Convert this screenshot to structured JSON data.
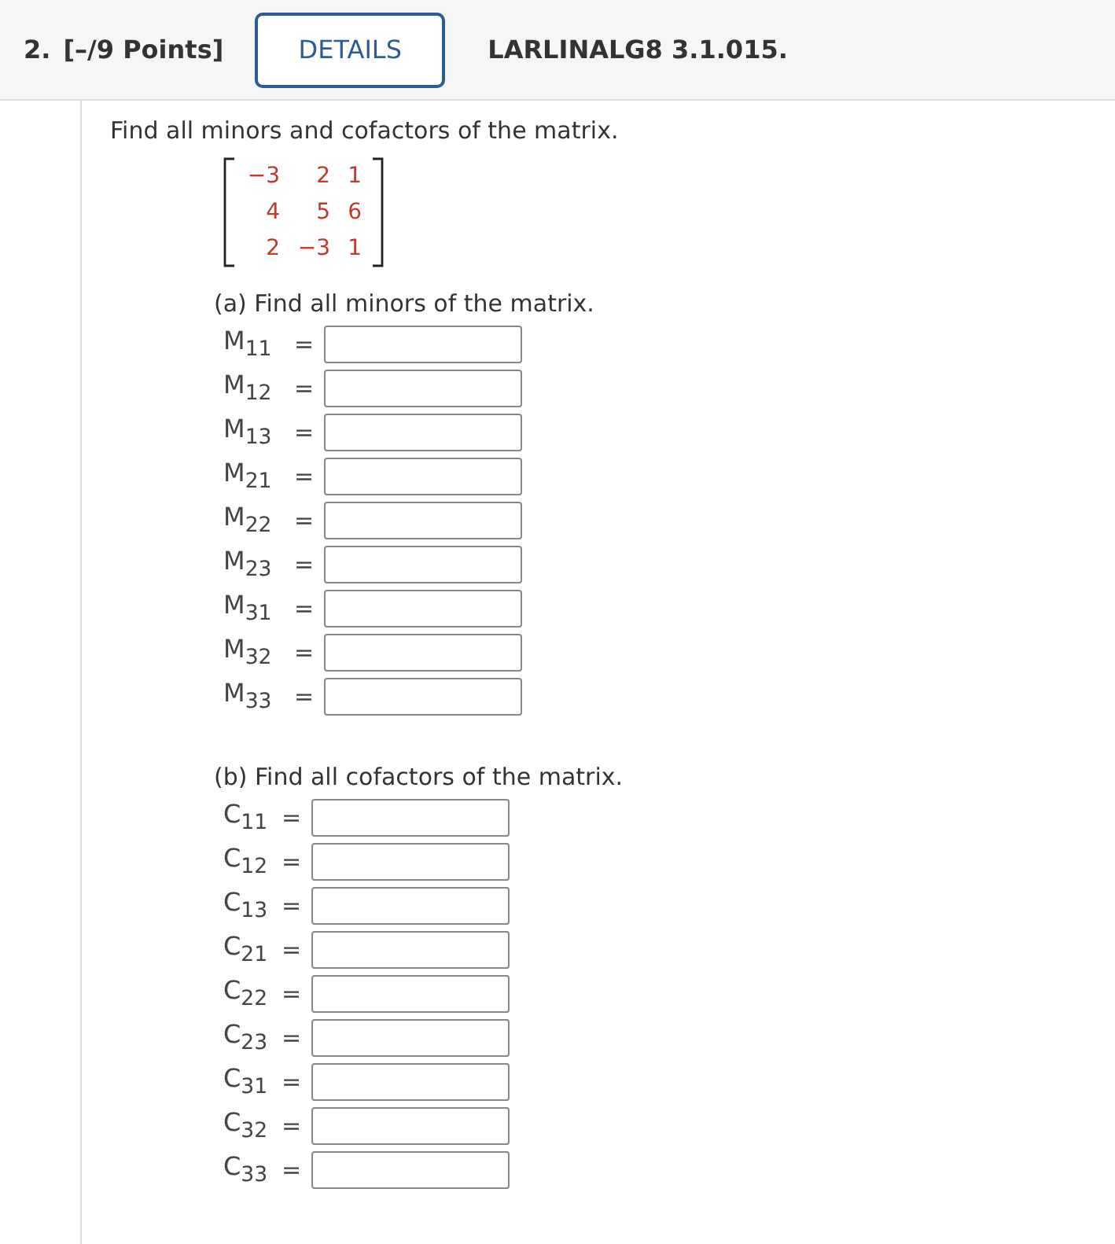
{
  "header": {
    "number": "2.",
    "points": "[–/9 Points]",
    "details_button": "DETAILS",
    "code": "LARLINALG8 3.1.015."
  },
  "prompt": "Find all minors and cofactors of the matrix.",
  "matrix": [
    [
      "−3",
      "2",
      "1"
    ],
    [
      "4",
      "5",
      "6"
    ],
    [
      "2",
      "−3",
      "1"
    ]
  ],
  "parts": [
    {
      "title": "(a) Find all minors of the matrix.",
      "answers": [
        {
          "label": "M$_{11}$",
          "sign": "="
        },
        {
          "label": "M$_{12}$",
          "sign": "="
        },
        {
          "label": "M$_{13}$",
          "sign": "="
        },
        {
          "label": "M$_{21}$",
          "sign": "="
        },
        {
          "label": "M$_{22}$",
          "sign": "="
        },
        {
          "label": "M$_{23}$",
          "sign": "="
        },
        {
          "label": "M$_{31}$",
          "sign": "="
        },
        {
          "label": "M$_{32}$",
          "sign": "="
        },
        {
          "label": "M$_{33}$",
          "sign": "="
        }
      ]
    },
    {
      "title": "(b) Find all cofactors of the matrix.",
      "answers": [
        {
          "label": "C$_{11}$",
          "sign": "="
        },
        {
          "label": "C$_{12}$",
          "sign": "="
        },
        {
          "label": "C$_{13}$",
          "sign": "="
        },
        {
          "label": "C$_{21}$",
          "sign": "="
        },
        {
          "label": "C$_{22}$",
          "sign": "="
        },
        {
          "label": "C$_{23}$",
          "sign": "="
        },
        {
          "label": "C$_{31}$",
          "sign": "="
        },
        {
          "label": "C$_{32}$",
          "sign": "="
        },
        {
          "label": "C$_{33}$",
          "sign": "="
        }
      ]
    }
  ]
}
